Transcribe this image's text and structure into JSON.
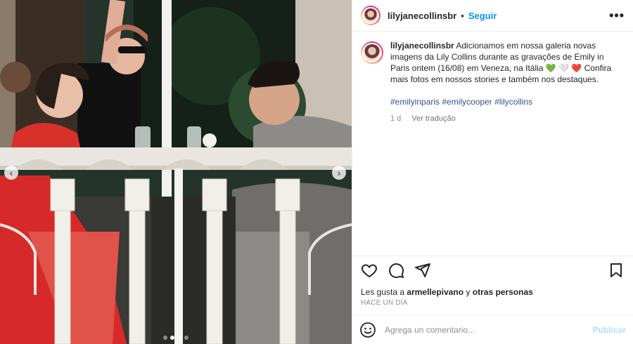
{
  "post": {
    "username": "lilyjanecollinsbr",
    "separator": "•",
    "follow_label": "Seguir",
    "more_icon": "more-options-icon",
    "caption": {
      "username": "lilyjanecollinsbr",
      "text": "Adicionamos em nossa galeria novas imagens da Lily Collins durante as gravações de Emily in Paris ontem (16/08) em Veneza, na Itália 💚 🤍 ❤️ Confira mais fotos em nossos stories e também nos destaques.",
      "hashtags": [
        "#emilyinparis",
        "#emilycooper",
        "#lilycollins"
      ],
      "age": "1 d",
      "translate_label": "Ver tradução"
    },
    "actions": {
      "like_icon": "heart-icon",
      "comment_icon": "comment-icon",
      "share_icon": "share-icon",
      "save_icon": "bookmark-icon"
    },
    "likes": {
      "prefix": "Les gusta a",
      "user": "armellepivano",
      "connector": "y",
      "others": "otras personas"
    },
    "time_ago": "HACE UN DÍA",
    "composer": {
      "emoji_icon": "emoji-icon",
      "placeholder": "Agrega un comentario...",
      "publish_label": "Publicar"
    }
  },
  "media": {
    "prev_icon": "chevron-left-icon",
    "next_icon": "chevron-right-icon",
    "carousel_count": 4,
    "carousel_active": 2
  }
}
